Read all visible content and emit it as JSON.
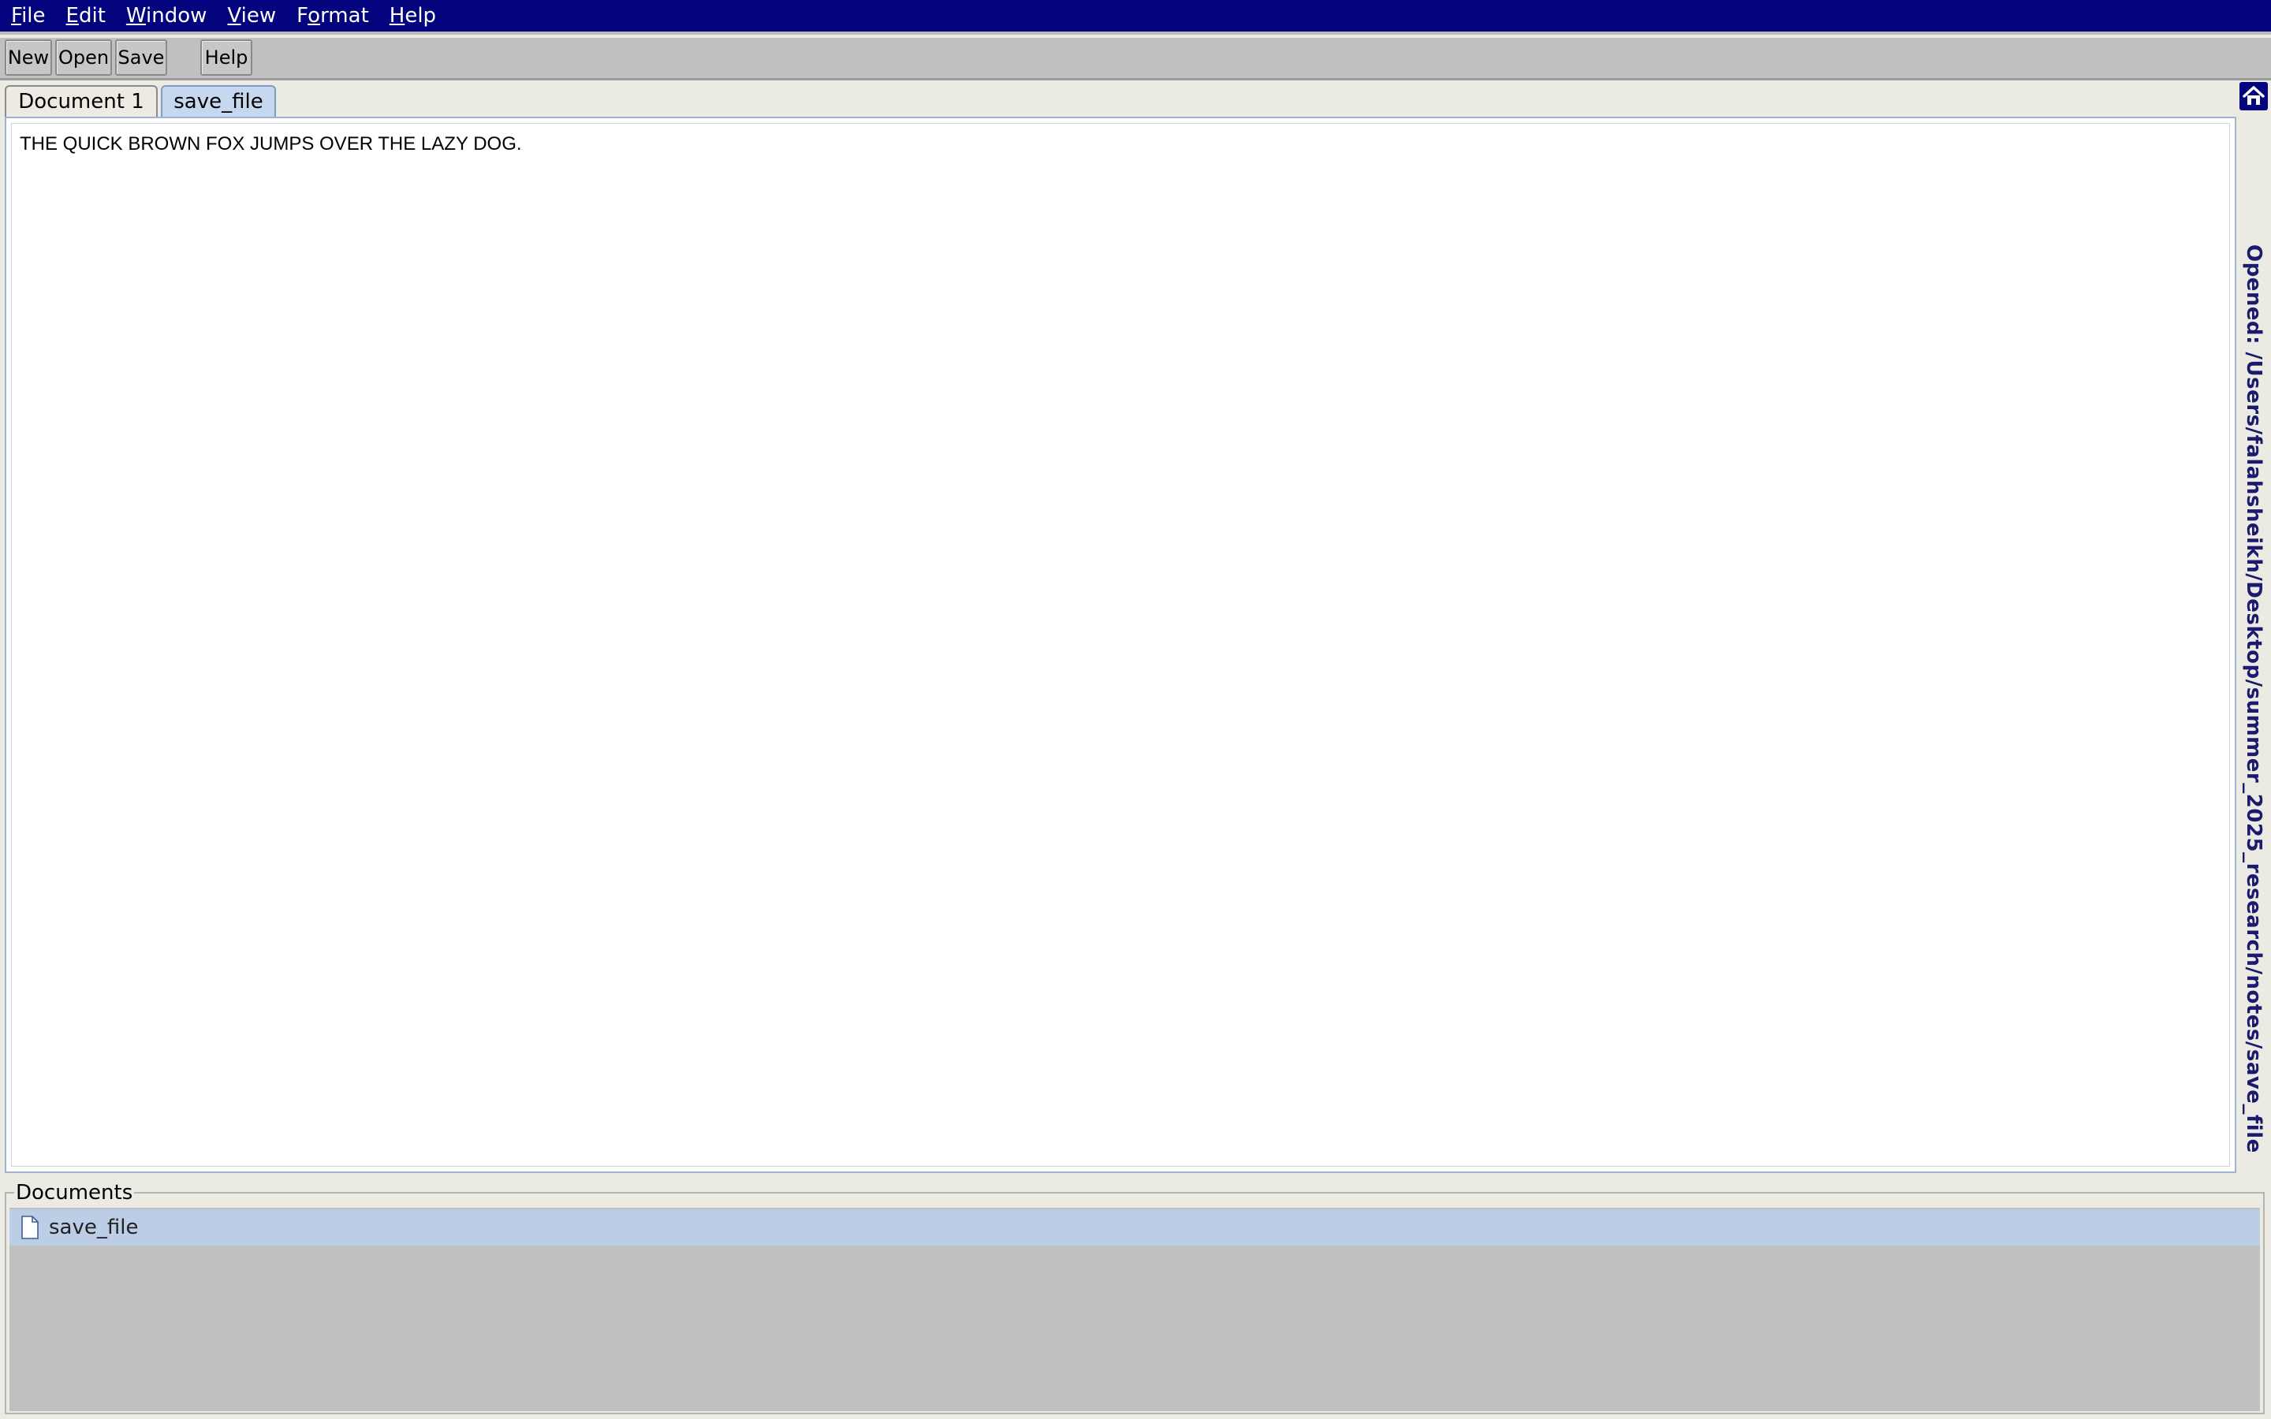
{
  "menubar": {
    "items": [
      {
        "mnemonic": "F",
        "rest": "ile"
      },
      {
        "mnemonic": "E",
        "rest": "dit"
      },
      {
        "mnemonic": "W",
        "rest": "indow"
      },
      {
        "mnemonic": "V",
        "rest": "iew"
      },
      {
        "pre": "F",
        "mnemonic": "o",
        "rest": "rmat"
      },
      {
        "mnemonic": "H",
        "rest": "elp"
      }
    ]
  },
  "toolbar": {
    "new_label": "New",
    "open_label": "Open",
    "save_label": "Save",
    "help_label": "Help"
  },
  "tabs": [
    {
      "label": "Document 1",
      "active": false
    },
    {
      "label": "save_file",
      "active": true
    }
  ],
  "editor": {
    "content": "THE QUICK BROWN FOX JUMPS OVER THE LAZY DOG."
  },
  "status": {
    "opened_text": "Opened: /Users/falahsheikh/Desktop/summer_2025_research/notes/save_file"
  },
  "documents": {
    "title": "Documents",
    "items": [
      {
        "name": "save_file",
        "selected": true,
        "icon": "document-icon"
      }
    ]
  },
  "colors": {
    "menubar_bg": "#03037e",
    "toolbar_bg": "#c0c0c0",
    "selection": "#bccde6",
    "status_text": "#1a1a6e"
  }
}
